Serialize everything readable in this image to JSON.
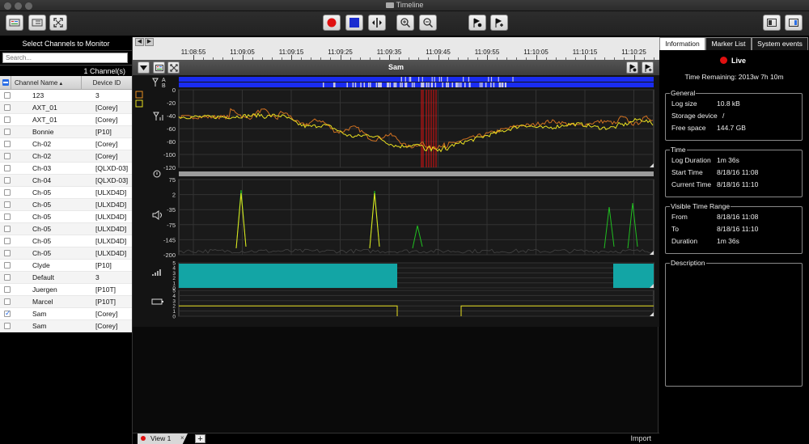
{
  "window": {
    "title": "Timeline"
  },
  "left_panel": {
    "title": "Select Channels to Monitor",
    "search_placeholder": "Search...",
    "count_label": "1  Channel(s)",
    "columns": {
      "name": "Channel Name",
      "device": "Device ID"
    },
    "rows": [
      {
        "name": "123",
        "device": "3",
        "checked": false
      },
      {
        "name": "AXT_01",
        "device": "[Corey]",
        "checked": false
      },
      {
        "name": "AXT_01",
        "device": "[Corey]",
        "checked": false
      },
      {
        "name": "Bonnie",
        "device": "[P10]",
        "checked": false
      },
      {
        "name": "Ch-02",
        "device": "[Corey]",
        "checked": false
      },
      {
        "name": "Ch-02",
        "device": "[Corey]",
        "checked": false
      },
      {
        "name": "Ch-03",
        "device": "[QLXD-03]",
        "checked": false
      },
      {
        "name": "Ch-04",
        "device": "[QLXD-03]",
        "checked": false
      },
      {
        "name": "Ch-05",
        "device": "[ULXD4D]",
        "checked": false
      },
      {
        "name": "Ch-05",
        "device": "[ULXD4D]",
        "checked": false
      },
      {
        "name": "Ch-05",
        "device": "[ULXD4D]",
        "checked": false
      },
      {
        "name": "Ch-05",
        "device": "[ULXD4D]",
        "checked": false
      },
      {
        "name": "Ch-05",
        "device": "[ULXD4D]",
        "checked": false
      },
      {
        "name": "Ch-05",
        "device": "[ULXD4D]",
        "checked": false
      },
      {
        "name": "Clyde",
        "device": "[P10]",
        "checked": false
      },
      {
        "name": "Default",
        "device": "3",
        "checked": false
      },
      {
        "name": "Juergen",
        "device": "[P10T]",
        "checked": false
      },
      {
        "name": "Marcel",
        "device": "[P10T]",
        "checked": false
      },
      {
        "name": "Sam",
        "device": "[Corey]",
        "checked": true
      },
      {
        "name": "Sam",
        "device": "[Corey]",
        "checked": false
      }
    ]
  },
  "timeline": {
    "ticks": [
      "11:08:55",
      "11:09:05",
      "11:09:15",
      "11:09:25",
      "11:09:35",
      "11:09:45",
      "11:09:55",
      "11:10:05",
      "11:10:15",
      "11:10:25"
    ],
    "channel_title": "Sam",
    "antenna_labels": {
      "a": "A",
      "b": "B"
    },
    "rf_ticks": [
      "0",
      "-20",
      "-40",
      "-60",
      "-80",
      "-100",
      "-120"
    ],
    "audio_ticks": [
      "75",
      "2",
      "-35",
      "-75",
      "-145",
      "-200"
    ],
    "quality_ticks": [
      "5",
      "4",
      "3",
      "2",
      "1",
      "0"
    ],
    "battery_ticks": [
      "5",
      "4",
      "3",
      "2",
      "1",
      "0"
    ],
    "colors": {
      "rf_a": "#e8e020",
      "rf_b": "#d07020",
      "antenna": "#1a2cf0",
      "interference": "#e01010",
      "audio": "#20c020",
      "quality": "#13a5a5",
      "battery": "#e8e020"
    }
  },
  "tabs": {
    "view_label": "View 1",
    "close": "×",
    "add": "+",
    "import_label": "Import"
  },
  "right_panel": {
    "tabs": [
      "Information",
      "Marker List",
      "System events"
    ],
    "live_label": "Live",
    "time_remaining": "Time Remaining: 2013w 7h 10m",
    "general": {
      "title": "General",
      "log_size_label": "Log size",
      "log_size": "10.8 kB",
      "storage_label": "Storage device",
      "storage": "/",
      "free_label": "Free space",
      "free": "144.7 GB"
    },
    "time": {
      "title": "Time",
      "duration_label": "Log Duration",
      "duration": "1m 36s",
      "start_label": "Start Time",
      "start": "8/18/16 11:08",
      "current_label": "Current Time",
      "current": "8/18/16 11:10"
    },
    "visible": {
      "title": "Visible Time Range",
      "from_label": "From",
      "from": "8/18/16 11:08",
      "to_label": "To",
      "to": "8/18/16 11:10",
      "duration_label": "Duration",
      "duration": "1m 36s"
    },
    "description": {
      "title": "Description"
    }
  }
}
